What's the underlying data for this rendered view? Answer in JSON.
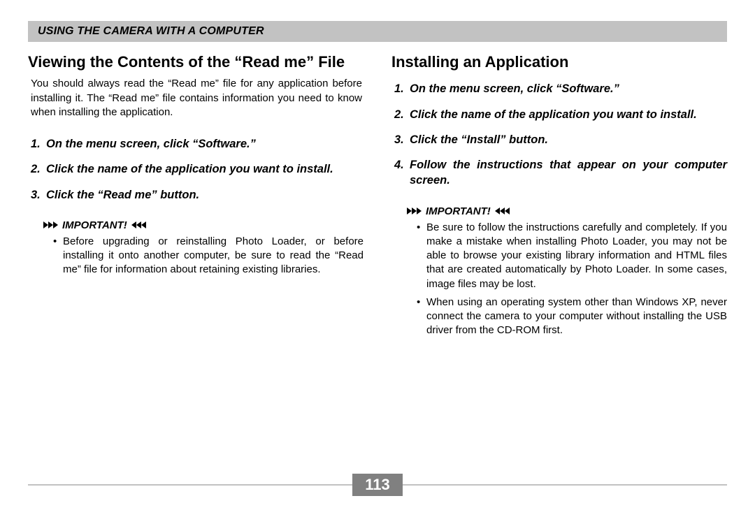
{
  "header": {
    "title": "USING THE CAMERA WITH A COMPUTER"
  },
  "left": {
    "heading": "Viewing the Contents of the “Read me” File",
    "intro": "You should always read the “Read me” file for any application before installing it. The “Read me” file contains information you need to know when installing the application.",
    "steps": [
      "On the menu screen, click “Software.”",
      "Click the name of the application you want to install.",
      "Click the “Read me” button."
    ],
    "important_label": "IMPORTANT!",
    "important": [
      "Before upgrading or reinstalling Photo Loader, or before installing it onto another computer, be sure to read the “Read me” file for information about retaining existing libraries."
    ]
  },
  "right": {
    "heading": "Installing an Application",
    "steps": [
      "On the menu screen, click “Software.”",
      "Click the name of the application you want to install.",
      "Click the “Install” button.",
      "Follow the instructions that appear on your computer screen."
    ],
    "important_label": "IMPORTANT!",
    "important": [
      "Be sure to follow the instructions carefully and completely. If you make a mistake when installing Photo Loader, you may not be able to browse your existing library information and HTML files that are created automatically by Photo Loader. In some cases, image files may be lost.",
      "When using an operating system other than Windows XP, never connect the camera to your computer without installing the USB driver from the CD-ROM first."
    ]
  },
  "page_number": "113"
}
